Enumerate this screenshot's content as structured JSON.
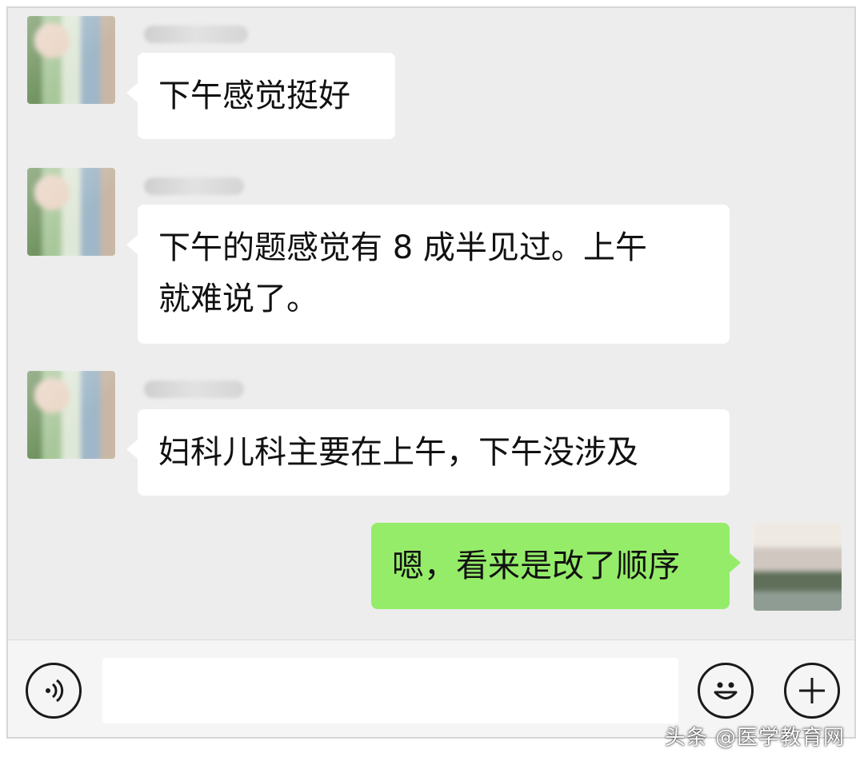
{
  "messages": [
    {
      "text": "下午感觉挺好",
      "side": "left"
    },
    {
      "text": "下午的题感觉有 8 成半见过。上午\n就难说了。",
      "side": "left"
    },
    {
      "text": "妇科儿科主要在上午，下午没涉及",
      "side": "left"
    },
    {
      "text": "嗯，看来是改了顺序",
      "side": "right"
    }
  ],
  "input": {
    "placeholder": ""
  },
  "icons": {
    "voice": "voice-icon",
    "emoji": "emoji-icon",
    "plus": "plus-icon"
  },
  "colors": {
    "background": "#ededed",
    "incoming_bubble": "#ffffff",
    "outgoing_bubble": "#95ec69"
  },
  "watermark": "头条 @医学教育网"
}
